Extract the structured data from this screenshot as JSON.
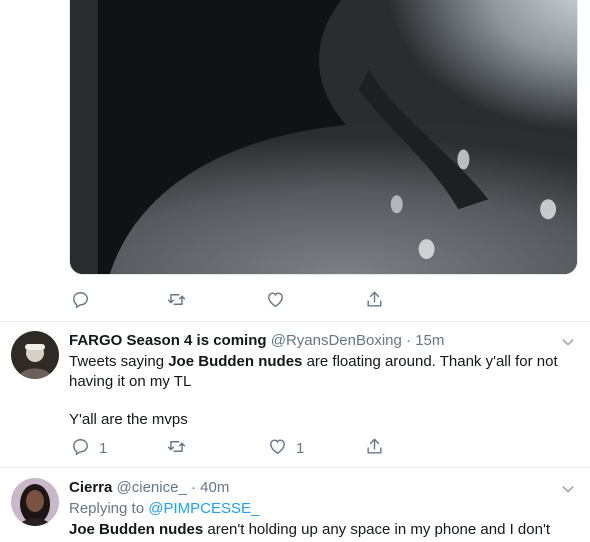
{
  "tweets": [
    {
      "name": "FARGO Season 4 is coming",
      "handle": "@RyansDenBoxing",
      "dot": "·",
      "time": "15m",
      "text_bold": "Joe Budden nudes",
      "text_pre": "Tweets saying ",
      "text_post": " are floating around. Thank y'all for not having it on my TL",
      "text_para2": "Y'all are the mvps",
      "reply_count": "1",
      "like_count": "1"
    },
    {
      "name": "Cierra",
      "handle": "@cienice_",
      "dot": "·",
      "time": "40m",
      "replying_label": "Replying to ",
      "replying_handle": "@PIMPCESSE_",
      "text_bold": "Joe Budden nudes",
      "text_post": " aren't holding up any space in my phone and I don't"
    }
  ],
  "icons": {
    "reply": "reply-icon",
    "retweet": "retweet-icon",
    "like": "heart-icon",
    "share": "share-icon",
    "more": "chevron-down-icon"
  },
  "colors": {
    "secondary_text": "#657786",
    "link": "#1da1f2",
    "divider": "#e6ecf0"
  }
}
